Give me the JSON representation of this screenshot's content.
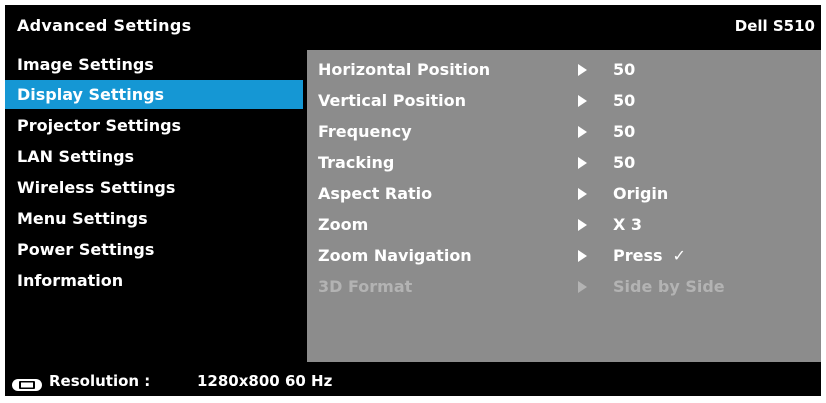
{
  "header": {
    "title": "Advanced Settings",
    "model": "Dell S510"
  },
  "sidebar": {
    "items": [
      {
        "label": "Image Settings"
      },
      {
        "label": "Display Settings",
        "selected": true
      },
      {
        "label": "Projector Settings"
      },
      {
        "label": "LAN Settings"
      },
      {
        "label": "Wireless Settings"
      },
      {
        "label": "Menu Settings"
      },
      {
        "label": "Power Settings"
      },
      {
        "label": "Information"
      }
    ]
  },
  "panel": {
    "rows": [
      {
        "label": "Horizontal Position",
        "value": "50"
      },
      {
        "label": "Vertical Position",
        "value": "50"
      },
      {
        "label": "Frequency",
        "value": "50"
      },
      {
        "label": "Tracking",
        "value": "50"
      },
      {
        "label": "Aspect Ratio",
        "value": "Origin"
      },
      {
        "label": "Zoom",
        "value": "X 3"
      },
      {
        "label": "Zoom Navigation",
        "value": "Press",
        "check": "✓"
      },
      {
        "label": "3D Format",
        "value": "Side by Side",
        "disabled": true
      }
    ]
  },
  "footer": {
    "icon": "monitor-input-icon",
    "label": "Resolution :",
    "value": "1280x800 60 Hz"
  },
  "colors": {
    "background": "#000000",
    "selection": "#1597d4",
    "panel": "#8c8c8c",
    "disabled_text": "#b3b3b3"
  }
}
